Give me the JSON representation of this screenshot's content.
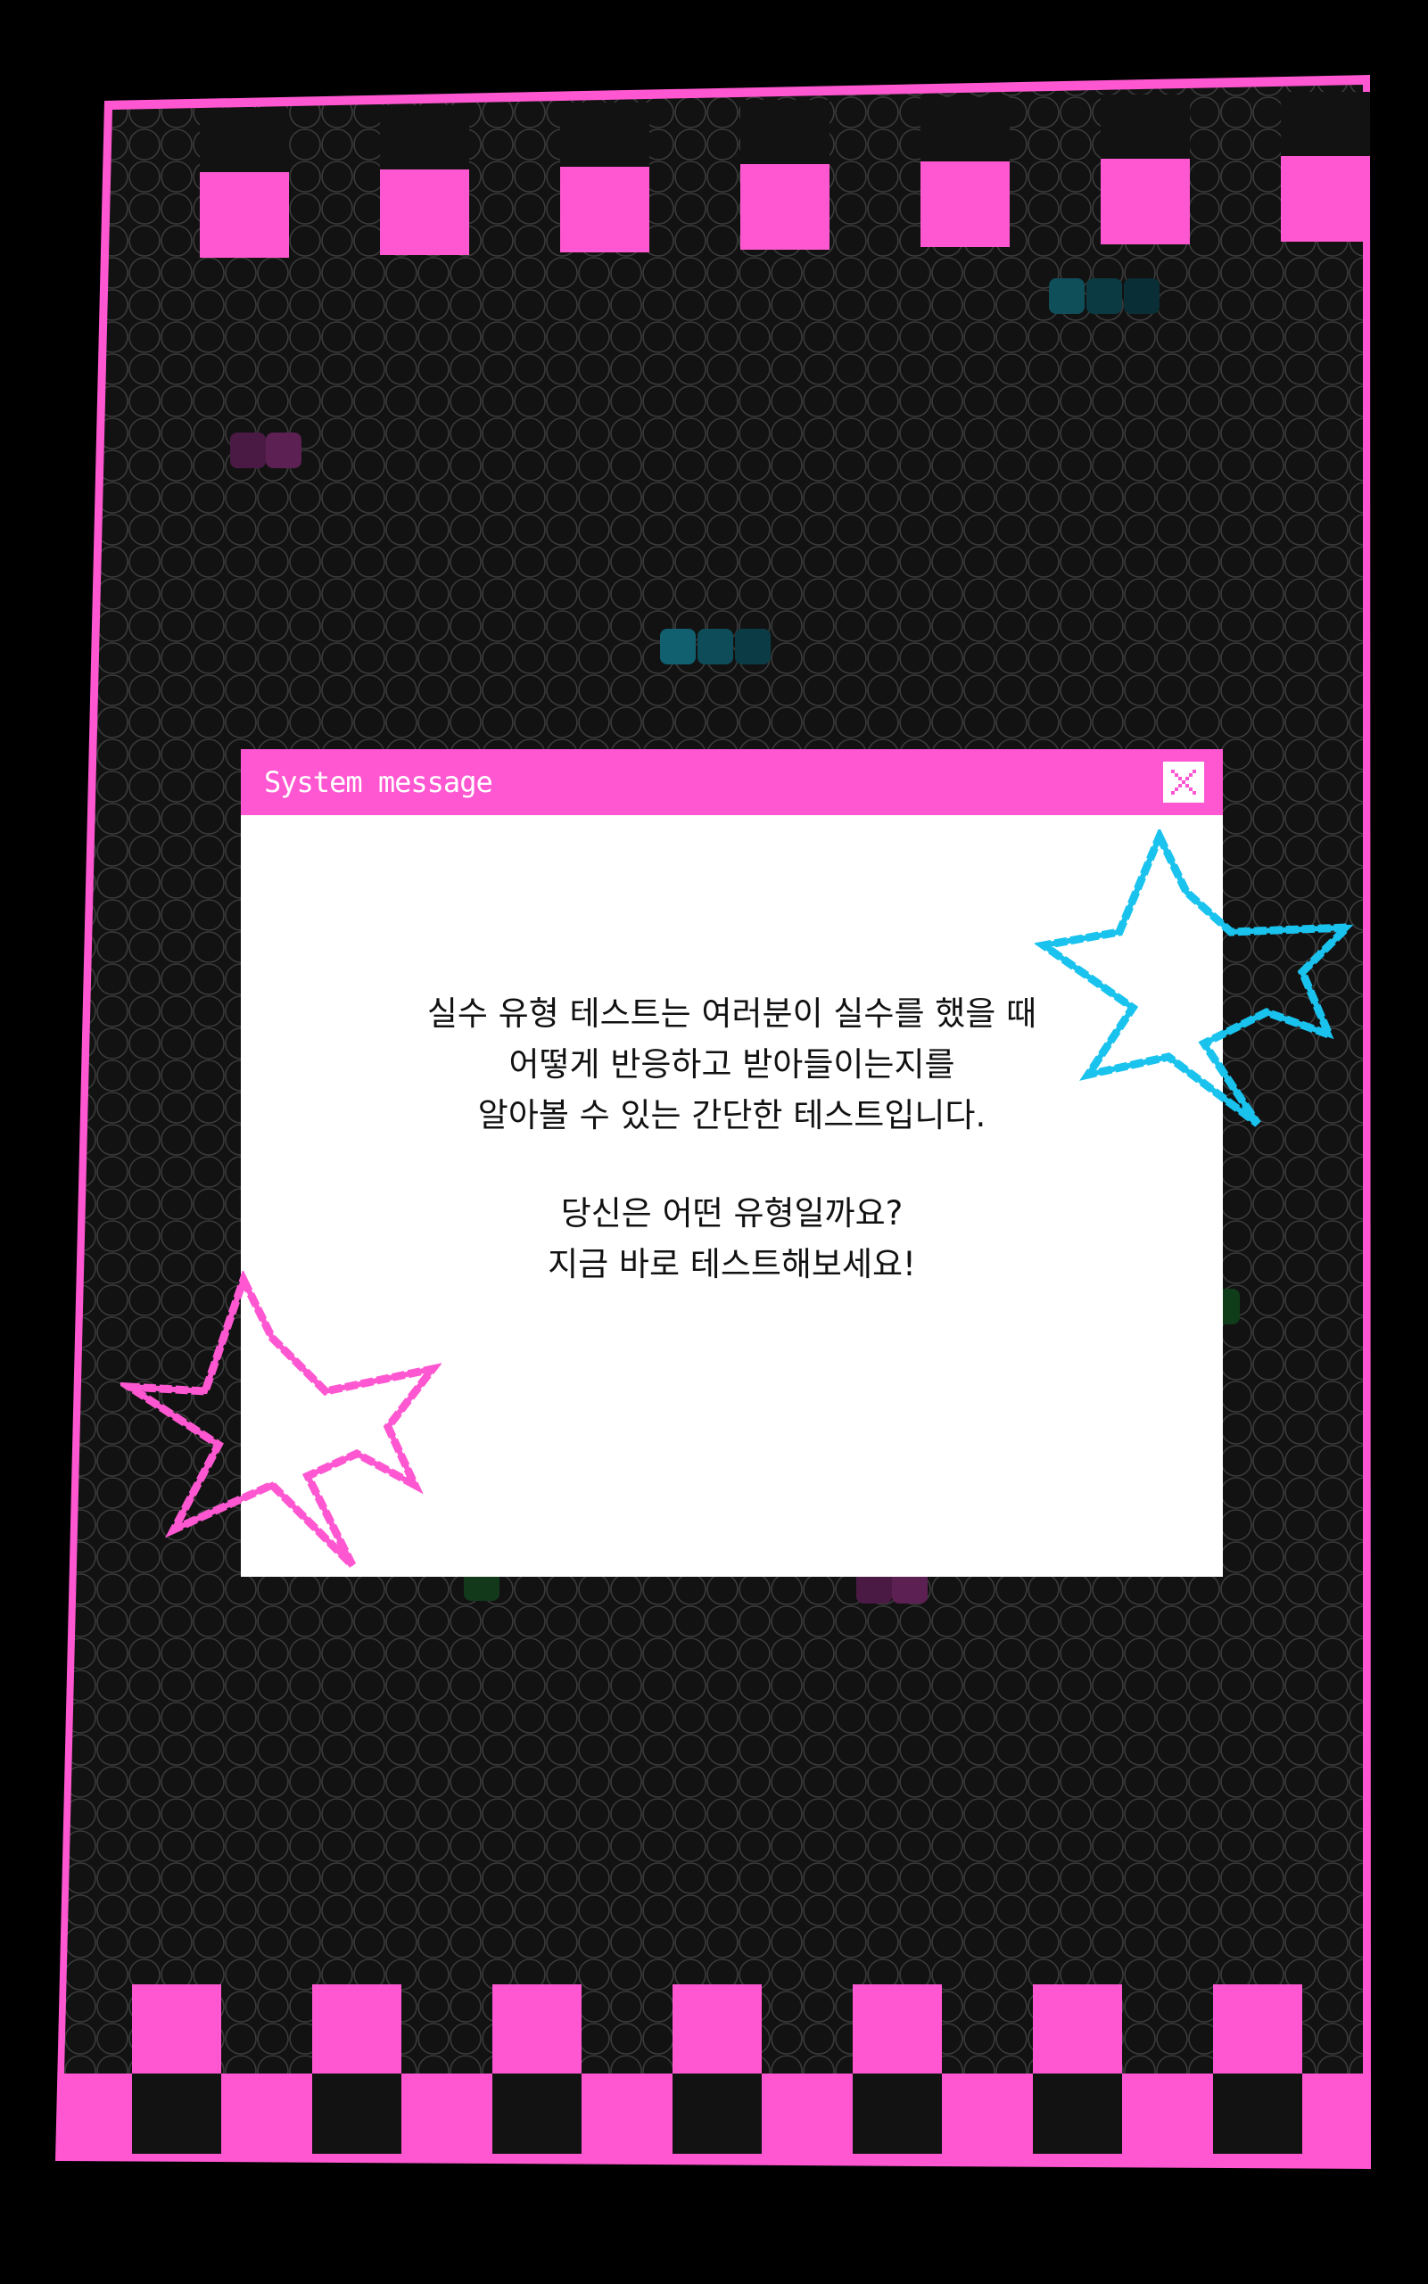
{
  "dialog": {
    "title": "System message",
    "close_icon": "close-x-icon",
    "message_lines": [
      "실수 유형 테스트는 여러분이 실수를 했을 때",
      "어떻게 반응하고 받아들이는지를",
      "알아볼 수 있는 간단한 테스트입니다."
    ],
    "cta_lines": [
      "당신은 어떤 유형일까요?",
      "지금 바로 테스트해보세요!"
    ]
  },
  "decorations": {
    "stars": [
      "cyan-star-icon",
      "pink-star-icon"
    ]
  },
  "colors": {
    "accent_pink": "#ff57d1",
    "star_cyan": "#19c3ee",
    "background_dark": "#121212",
    "outer_background": "#000000",
    "dialog_background": "#ffffff"
  }
}
